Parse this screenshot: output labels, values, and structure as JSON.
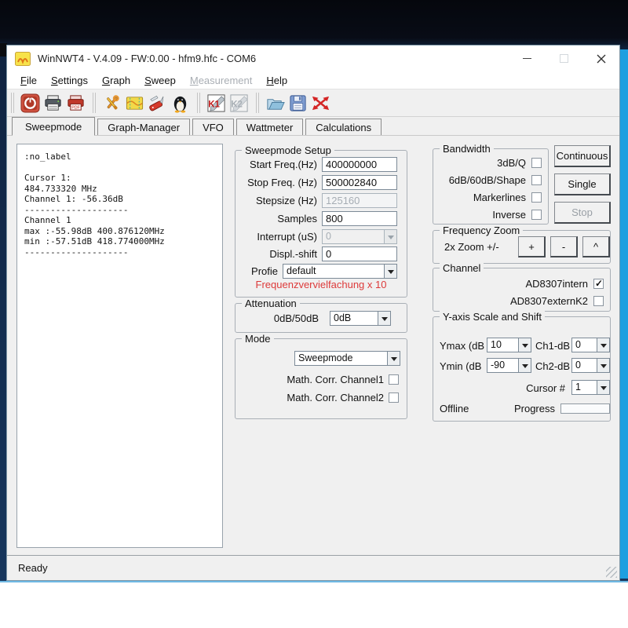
{
  "window": {
    "title": "WinNWT4 - V.4.09 - FW:0.00 - hfm9.hfc - COM6"
  },
  "colors": {
    "accent_red": "#dd3a3a",
    "strip_blue": "#1e9fe0",
    "disabled_text": "#9aa0a6"
  },
  "menu": {
    "items": [
      {
        "label": "File",
        "disabled": false
      },
      {
        "label": "Settings",
        "disabled": false
      },
      {
        "label": "Graph",
        "disabled": false
      },
      {
        "label": "Sweep",
        "disabled": false
      },
      {
        "label": "Measurement",
        "disabled": true
      },
      {
        "label": "Help",
        "disabled": false
      }
    ]
  },
  "toolbar": {
    "icons": [
      "power",
      "print",
      "print-pdf",
      "tools",
      "toolbox",
      "pocket-knife",
      "penguin",
      "k1",
      "k2",
      "open-file",
      "save-file",
      "disconnect"
    ],
    "pdf_label": "PDF",
    "k1_label": "K1",
    "k2_label": "K2"
  },
  "tabs": {
    "active": "Sweepmode",
    "items": [
      "Sweepmode",
      "Graph-Manager",
      "VFO",
      "Wattmeter",
      "Calculations"
    ]
  },
  "info_panel": {
    "text": ":no_label\n\nCursor 1:\n484.733320 MHz\nChannel 1: -56.36dB\n--------------------\nChannel 1\nmax :-55.98dB 400.876120MHz\nmin :-57.51dB 418.774000MHz\n--------------------"
  },
  "sweep_setup": {
    "title": "Sweepmode Setup",
    "fields": [
      {
        "label": "Start Freq.(Hz)",
        "value": "400000000",
        "disabled": false
      },
      {
        "label": "Stop Freq. (Hz)",
        "value": "500002840",
        "disabled": false
      },
      {
        "label": "Stepsize (Hz)",
        "value": "125160",
        "disabled": true
      },
      {
        "label": "Samples",
        "value": "800",
        "disabled": false
      },
      {
        "label": "Interrupt (uS)",
        "value": "0",
        "disabled": true
      },
      {
        "label": "Displ.-shift",
        "value": "0",
        "disabled": false
      },
      {
        "label": "Profie",
        "value": "default",
        "disabled": false
      }
    ],
    "note": "Frequenzvervielfachung x 10"
  },
  "attenuation": {
    "title": "Attenuation",
    "label": "0dB/50dB",
    "value": "0dB"
  },
  "mode": {
    "title": "Mode",
    "selected": "Sweepmode",
    "checkboxes": [
      {
        "label": "Math. Corr. Channel1",
        "checked": false
      },
      {
        "label": "Math. Corr. Channel2",
        "checked": false
      }
    ]
  },
  "bandwidth": {
    "title": "Bandwidth",
    "checkboxes": [
      {
        "label": "3dB/Q",
        "checked": false
      },
      {
        "label": "6dB/60dB/Shape",
        "checked": false
      },
      {
        "label": "Markerlines",
        "checked": false
      },
      {
        "label": "Inverse",
        "checked": false
      }
    ]
  },
  "run_controls": {
    "buttons": [
      {
        "label": "Continuous",
        "disabled": false
      },
      {
        "label": "Single",
        "disabled": false
      },
      {
        "label": "Stop",
        "disabled": true
      }
    ]
  },
  "frequency_zoom": {
    "title": "Frequency Zoom",
    "label": "2x Zoom +/-",
    "buttons": [
      "+",
      "-",
      "^"
    ]
  },
  "channel": {
    "title": "Channel",
    "checkboxes": [
      {
        "label": "AD8307intern",
        "checked": true
      },
      {
        "label": "AD8307externK2",
        "checked": false
      }
    ]
  },
  "yaxis": {
    "title": "Y-axis Scale and Shift",
    "ymax": {
      "label": "Ymax (dB",
      "value": "10"
    },
    "ch1": {
      "label": "Ch1-dB",
      "value": "0"
    },
    "ymin": {
      "label": "Ymin (dB",
      "value": "-90"
    },
    "ch2": {
      "label": "Ch2-dB",
      "value": "0"
    },
    "cursor": {
      "label": "Cursor #",
      "value": "1"
    },
    "offline": "Offline",
    "progress_label": "Progress"
  },
  "status_bar": {
    "text": "Ready"
  }
}
